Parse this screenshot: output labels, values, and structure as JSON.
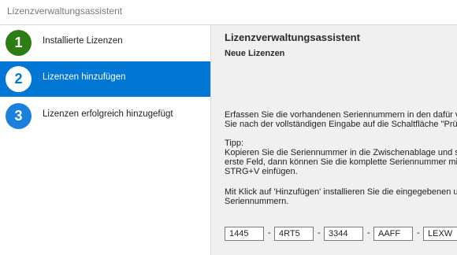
{
  "window": {
    "title": "Lizenzverwaltungsassistent"
  },
  "sidebar": {
    "steps": [
      {
        "number": "1",
        "label": "Installierte Lizenzen",
        "state": "done"
      },
      {
        "number": "2",
        "label": "Lizenzen hinzufügen",
        "state": "active"
      },
      {
        "number": "3",
        "label": "Lizenzen erfolgreich hinzugefügt",
        "state": "todo"
      }
    ]
  },
  "main": {
    "title": "Lizenzverwaltungsassistent",
    "subtitle": "Neue Lizenzen",
    "paragraphs": [
      "Erfassen Sie die vorhandenen Seriennummern in den dafür vo\nSie nach der vollständigen Eingabe auf die Schaltfläche \"Prüfe",
      "Tipp:\nKopieren Sie die Seriennummer in die Zwischenablage und setz\nerste Feld, dann können Sie die komplette Seriennummer mit d\nSTRG+V einfügen.",
      "Mit Klick auf 'Hinzufügen' installieren Sie die eingegebenen und\nSeriennummern."
    ],
    "serial_fields": [
      "1445",
      "4RT5",
      "3344",
      "AAFF",
      "LEXW"
    ],
    "separator": "-"
  },
  "colors": {
    "active_step": "#0077d4",
    "done_step": "#2e7d14",
    "todo_step": "#1a80dc",
    "main_background": "#f0f0f0"
  }
}
